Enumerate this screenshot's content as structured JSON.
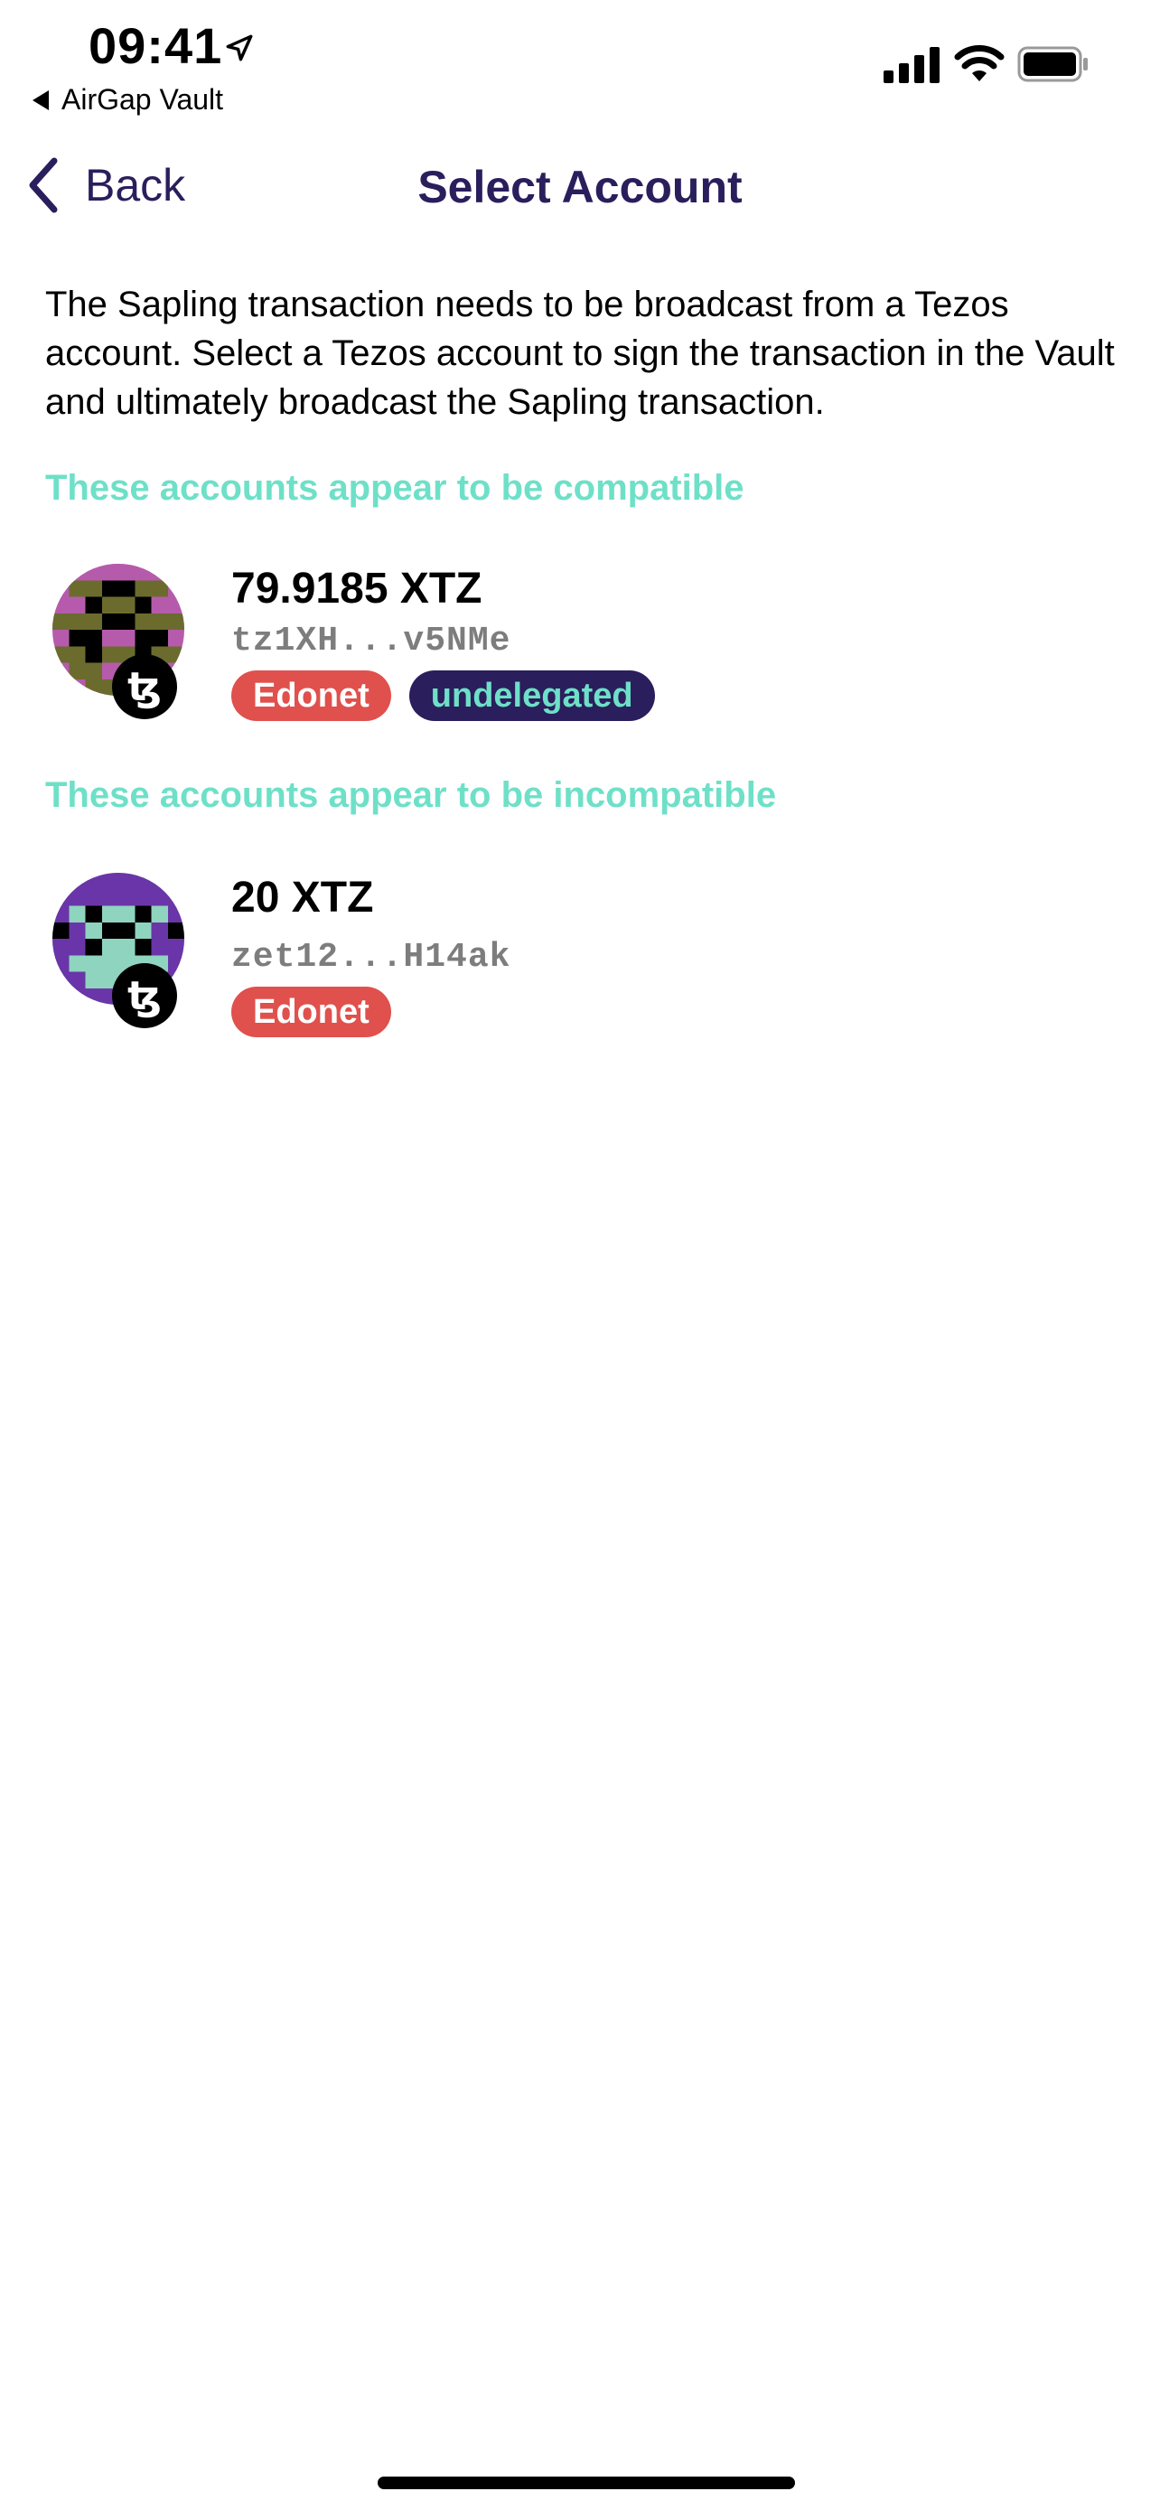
{
  "status_bar": {
    "time": "09:41",
    "back_app_label": "AirGap Vault"
  },
  "nav": {
    "back_label": "Back",
    "title": "Select Account"
  },
  "intro_text": "The Sapling transaction needs to be broadcast from a Tezos account. Select a Tezos account to sign the transaction in the Vault and ultimately broadcast the Sapling transaction.",
  "sections": {
    "compatible_title": "These accounts appear to be compatible",
    "incompatible_title": "These accounts appear to be incompatible"
  },
  "accounts": [
    {
      "amount": "79.9185 XTZ",
      "address": "tz1XH...v5NMe",
      "network_badge": "Edonet",
      "delegation_badge": "undelegated",
      "coin_icon": "tezos-icon"
    },
    {
      "amount": "20 XTZ",
      "address": "zet12...H14ak",
      "network_badge": "Edonet",
      "coin_icon": "tezos-icon"
    }
  ],
  "colors": {
    "nav_text": "#2a1e5c",
    "section_title": "#6ee0c8",
    "network_badge_bg": "#e0504d",
    "delegation_badge_bg": "#2a1e5c"
  }
}
